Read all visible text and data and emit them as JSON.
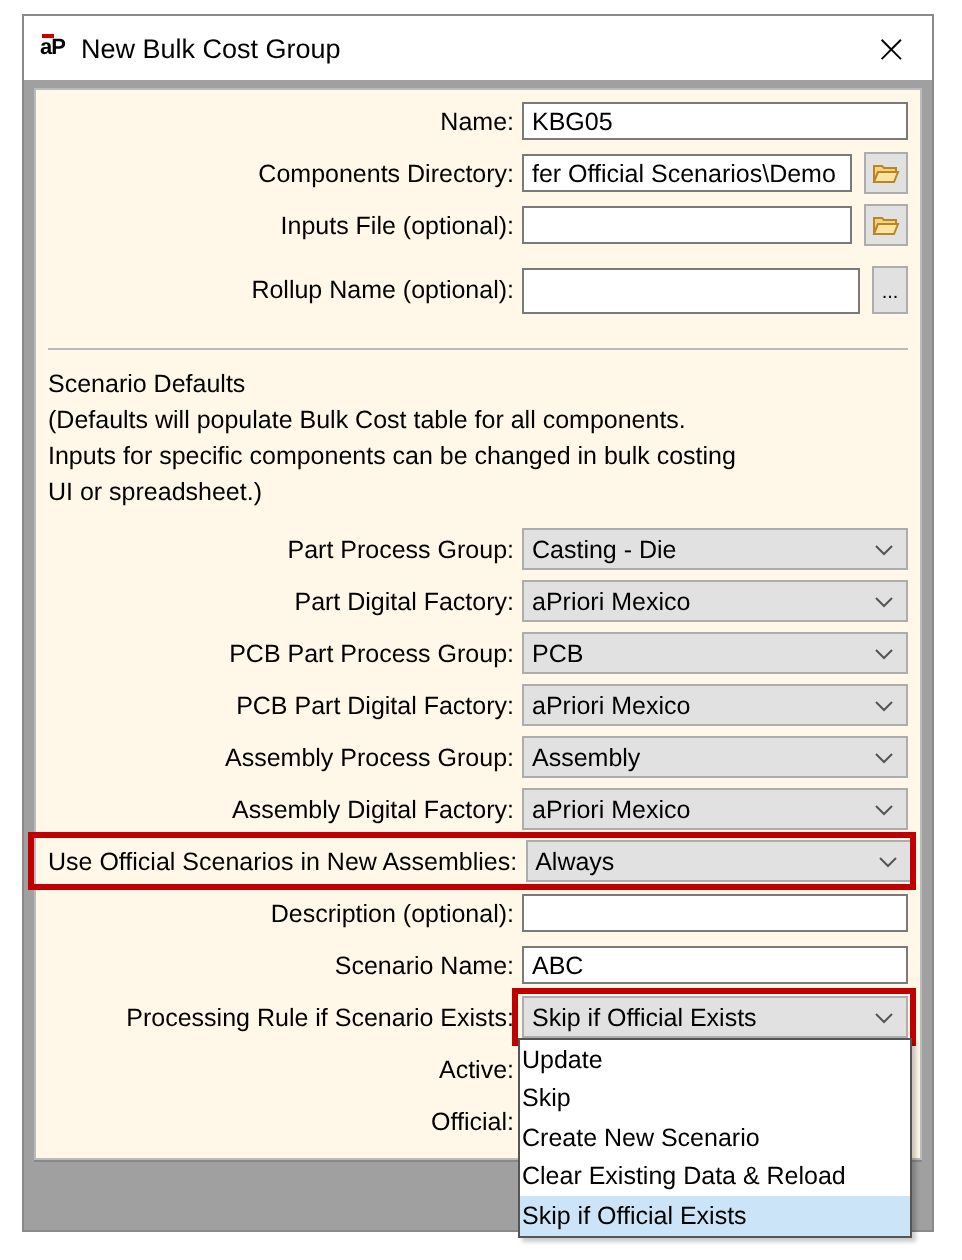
{
  "window": {
    "logo": "aP",
    "title": "New Bulk Cost Group",
    "close": "×"
  },
  "fields": [
    {
      "kind": "text",
      "label": "Name:",
      "value": "KBG05"
    },
    {
      "kind": "browse",
      "label": "Components Directory:",
      "value": "fer Official Scenarios\\Demo"
    },
    {
      "kind": "browse",
      "label": "Inputs File (optional):"
    },
    {
      "kind": "more",
      "label": "Rollup Name (optional):",
      "button": "..."
    }
  ],
  "section": {
    "title": "Scenario Defaults",
    "note_lines": [
      "(Defaults will populate Bulk Cost table for all components.",
      "Inputs for specific components can be changed in bulk costing",
      "UI or spreadsheet.)"
    ]
  },
  "defaults": [
    {
      "kind": "select",
      "label": "Part Process Group:",
      "value": "Casting - Die"
    },
    {
      "kind": "select",
      "label": "Part Digital Factory:",
      "value": "aPriori Mexico"
    },
    {
      "kind": "select",
      "label": "PCB Part Process Group:",
      "value": "PCB"
    },
    {
      "kind": "select",
      "label": "PCB Part Digital Factory:",
      "value": "aPriori Mexico"
    },
    {
      "kind": "select",
      "label": "Assembly Process Group:",
      "value": "Assembly"
    },
    {
      "kind": "select",
      "label": "Assembly Digital Factory:",
      "value": "aPriori Mexico"
    },
    {
      "kind": "select",
      "label": "Use Official Scenarios in New Assemblies:",
      "value": "Always",
      "row_highlighted": true
    },
    {
      "kind": "text",
      "label": "Description (optional):"
    },
    {
      "kind": "text",
      "label": "Scenario Name:",
      "value": "ABC"
    },
    {
      "kind": "select",
      "label": "Processing Rule if Scenario Exists:",
      "value": "Skip if Official Exists",
      "control_highlighted": true
    },
    {
      "kind": "label",
      "label": "Active:"
    },
    {
      "kind": "label",
      "label": "Official:"
    }
  ],
  "dropdown": {
    "options": [
      {
        "label": "Update",
        "selected": false
      },
      {
        "label": "Skip",
        "selected": false
      },
      {
        "label": "Create New Scenario",
        "selected": false
      },
      {
        "label": "Clear Existing Data & Reload",
        "selected": false
      },
      {
        "label": "Skip if Official Exists",
        "selected": true
      }
    ]
  }
}
